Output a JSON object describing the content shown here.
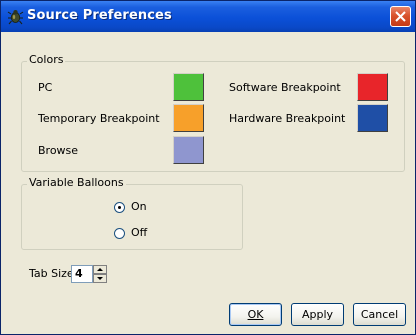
{
  "window": {
    "title": "Source Preferences"
  },
  "colors_group": {
    "legend": "Colors",
    "items": [
      {
        "label": "PC",
        "color": "#4ec13b"
      },
      {
        "label": "Temporary Breakpoint",
        "color": "#f7a02a"
      },
      {
        "label": "Browse",
        "color": "#8f96cf"
      },
      {
        "label": "Software Breakpoint",
        "color": "#e8252a"
      },
      {
        "label": "Hardware Breakpoint",
        "color": "#1f4fa6"
      }
    ]
  },
  "balloons_group": {
    "legend": "Variable Balloons",
    "options": [
      {
        "label": "On",
        "selected": true
      },
      {
        "label": "Off",
        "selected": false
      }
    ]
  },
  "tab_size": {
    "label": "Tab Size",
    "value": "4"
  },
  "buttons": {
    "ok": "OK",
    "apply": "Apply",
    "cancel": "Cancel"
  },
  "icons": {
    "app": "bug-icon",
    "close": "close-icon",
    "spin_up": "triangle-up-icon",
    "spin_down": "triangle-down-icon"
  }
}
